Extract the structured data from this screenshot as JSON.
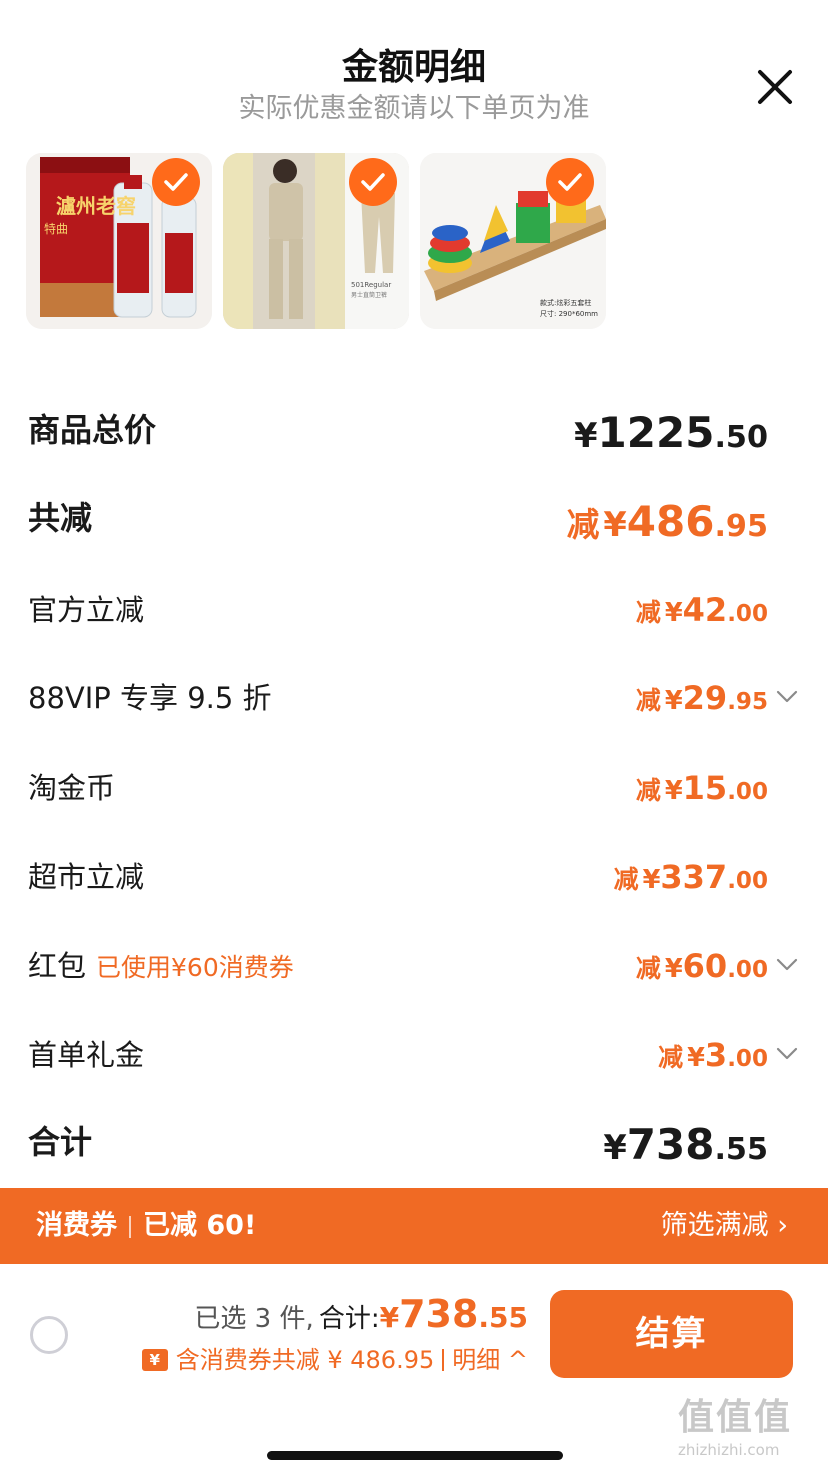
{
  "header": {
    "title": "金额明细",
    "subtitle": "实际优惠金额请以下单页为准"
  },
  "products": [
    {
      "name": "泸州老窖 特曲 白酒礼盒",
      "art_text_1": "瀘州老窖",
      "art_text_2": "特曲",
      "selected": true
    },
    {
      "name": "男士卫裤 501Regular",
      "art_text_1": "501Regular",
      "art_text_2": "男士直筒卫裤",
      "selected": true
    },
    {
      "name": "积木 形状套柱玩具",
      "art_text_1": "款式:炫彩五套柱",
      "art_text_2": "尺寸: 290*60mm",
      "selected": true
    }
  ],
  "breakdown": {
    "total_price": {
      "label": "商品总价",
      "yen": "¥",
      "int": "1225",
      "dec": ".50"
    },
    "total_discount": {
      "label": "共减",
      "prefix": "减",
      "yen": "¥",
      "int": "486",
      "dec": ".95"
    },
    "items": [
      {
        "label": "官方立减",
        "note": "",
        "prefix": "减",
        "yen": "¥",
        "int": "42",
        "dec": ".00",
        "expandable": false
      },
      {
        "label": "88VIP 专享 9.5 折",
        "note": "",
        "prefix": "减",
        "yen": "¥",
        "int": "29",
        "dec": ".95",
        "expandable": true
      },
      {
        "label": "淘金币",
        "note": "",
        "prefix": "减",
        "yen": "¥",
        "int": "15",
        "dec": ".00",
        "expandable": false
      },
      {
        "label": "超市立减",
        "note": "",
        "prefix": "减",
        "yen": "¥",
        "int": "337",
        "dec": ".00",
        "expandable": false
      },
      {
        "label": "红包",
        "note": "已使用¥60消费券",
        "prefix": "减",
        "yen": "¥",
        "int": "60",
        "dec": ".00",
        "expandable": true
      },
      {
        "label": "首单礼金",
        "note": "",
        "prefix": "减",
        "yen": "¥",
        "int": "3",
        "dec": ".00",
        "expandable": true
      }
    ],
    "grand_total": {
      "label": "合计",
      "yen": "¥",
      "int": "738",
      "dec": ".55"
    }
  },
  "banner": {
    "left_a": "消费券",
    "left_b": "已减 60!",
    "right": "筛选满减 ›"
  },
  "footer": {
    "selected_text": "已选 3 件,",
    "total_label": "合计:",
    "yen": "¥",
    "int": "738",
    "dec": ".55",
    "coupon_icon": "¥",
    "discount_text": "含消费券共减 ¥ 486.95",
    "detail_text": "明细 ^",
    "checkout_label": "结算"
  },
  "watermark": {
    "logo": "值值值",
    "url": "zhizhizhi.com"
  },
  "colors": {
    "accent": "#f06a24",
    "check": "#ff6a1a",
    "subtitle": "#9a9a9a"
  },
  "icons": [
    "close-icon",
    "check-icon",
    "chevron-down-icon",
    "chevron-right-icon",
    "chevron-up-icon",
    "coupon-icon"
  ]
}
